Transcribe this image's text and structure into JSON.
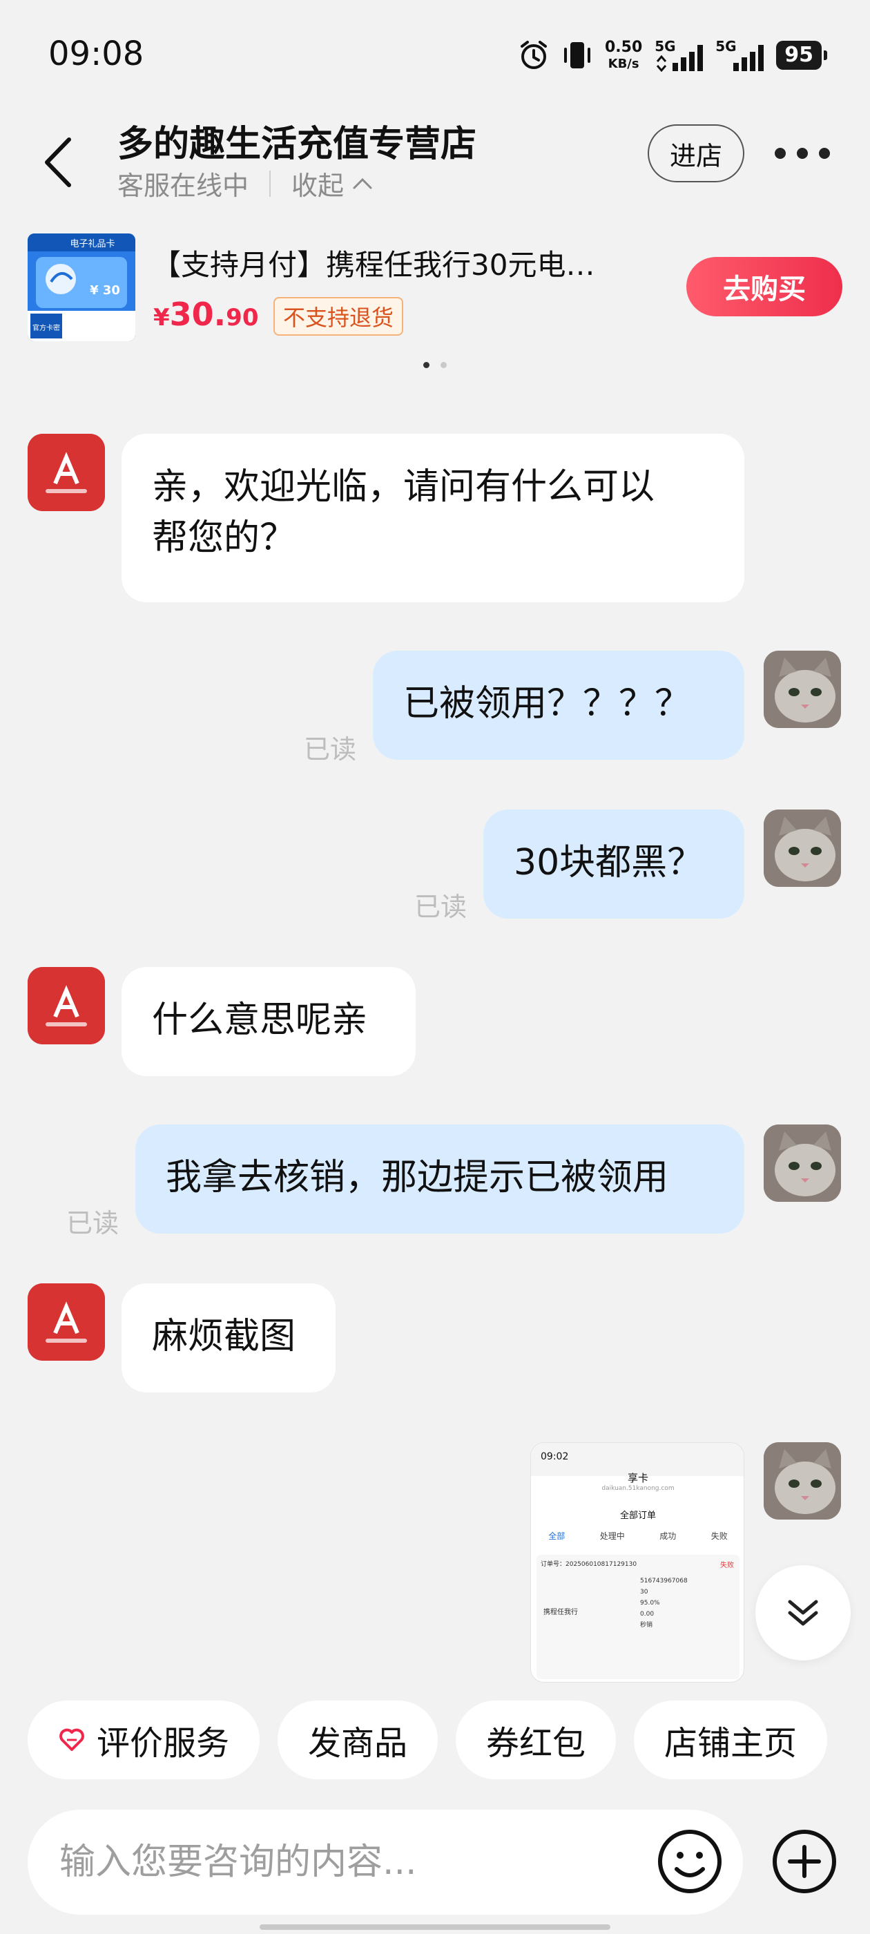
{
  "status_bar": {
    "time": "09:08",
    "net_speed_value": "0.50",
    "net_speed_unit": "KB/s",
    "signal_1_label": "5G",
    "signal_2_label": "5G",
    "battery": "95"
  },
  "header": {
    "title": "多的趣生活充值专营店",
    "status": "客服在线中",
    "collapse_label": "收起",
    "enter_shop_label": "进店"
  },
  "product": {
    "name": "【支持月付】携程任我行30元电…",
    "price_symbol": "¥",
    "price_int": "30.",
    "price_dec": "90",
    "tag": "不支持退货",
    "buy_label": "去购买",
    "thumb_text_top": "电子礼品卡",
    "thumb_value": "¥ 30",
    "thumb_text_bottom": "官方卡密"
  },
  "messages": [
    {
      "from": "shop",
      "text_line1": "亲，欢迎光临，请问有什么可以",
      "text_line2": "帮您的？"
    },
    {
      "from": "user",
      "text": "已被领用？？？？",
      "read": "已读"
    },
    {
      "from": "user",
      "text": "30块都黑？",
      "read": "已读"
    },
    {
      "from": "shop",
      "text": "什么意思呢亲"
    },
    {
      "from": "user",
      "text": "我拿去核销，那边提示已被领用",
      "read": "已读"
    },
    {
      "from": "shop",
      "text": "麻烦截图"
    }
  ],
  "screenshot_msg": {
    "time": "09:02",
    "app_title": "享卡",
    "app_url": "daikuan.51kanong.com",
    "page_title": "全部订单",
    "tabs": [
      "全部",
      "处理中",
      "成功",
      "失败"
    ],
    "order_no": "订单号：20250601081712913​0",
    "order_status": "失败",
    "product_name": "携程任我行",
    "card_no": "516743967068",
    "face_value": "30",
    "discount": "95.0%",
    "amount": "0.00",
    "speed": "秒销"
  },
  "quick_actions": [
    {
      "label": "评价服务",
      "icon": "heart-icon"
    },
    {
      "label": "发商品"
    },
    {
      "label": "券红包"
    },
    {
      "label": "店铺主页"
    }
  ],
  "input": {
    "placeholder": "输入您要咨询的内容..."
  },
  "colors": {
    "accent_red": "#f0274a",
    "bubble_out": "#d9ecff",
    "bubble_in": "#ffffff",
    "background": "#f2f2f2"
  }
}
